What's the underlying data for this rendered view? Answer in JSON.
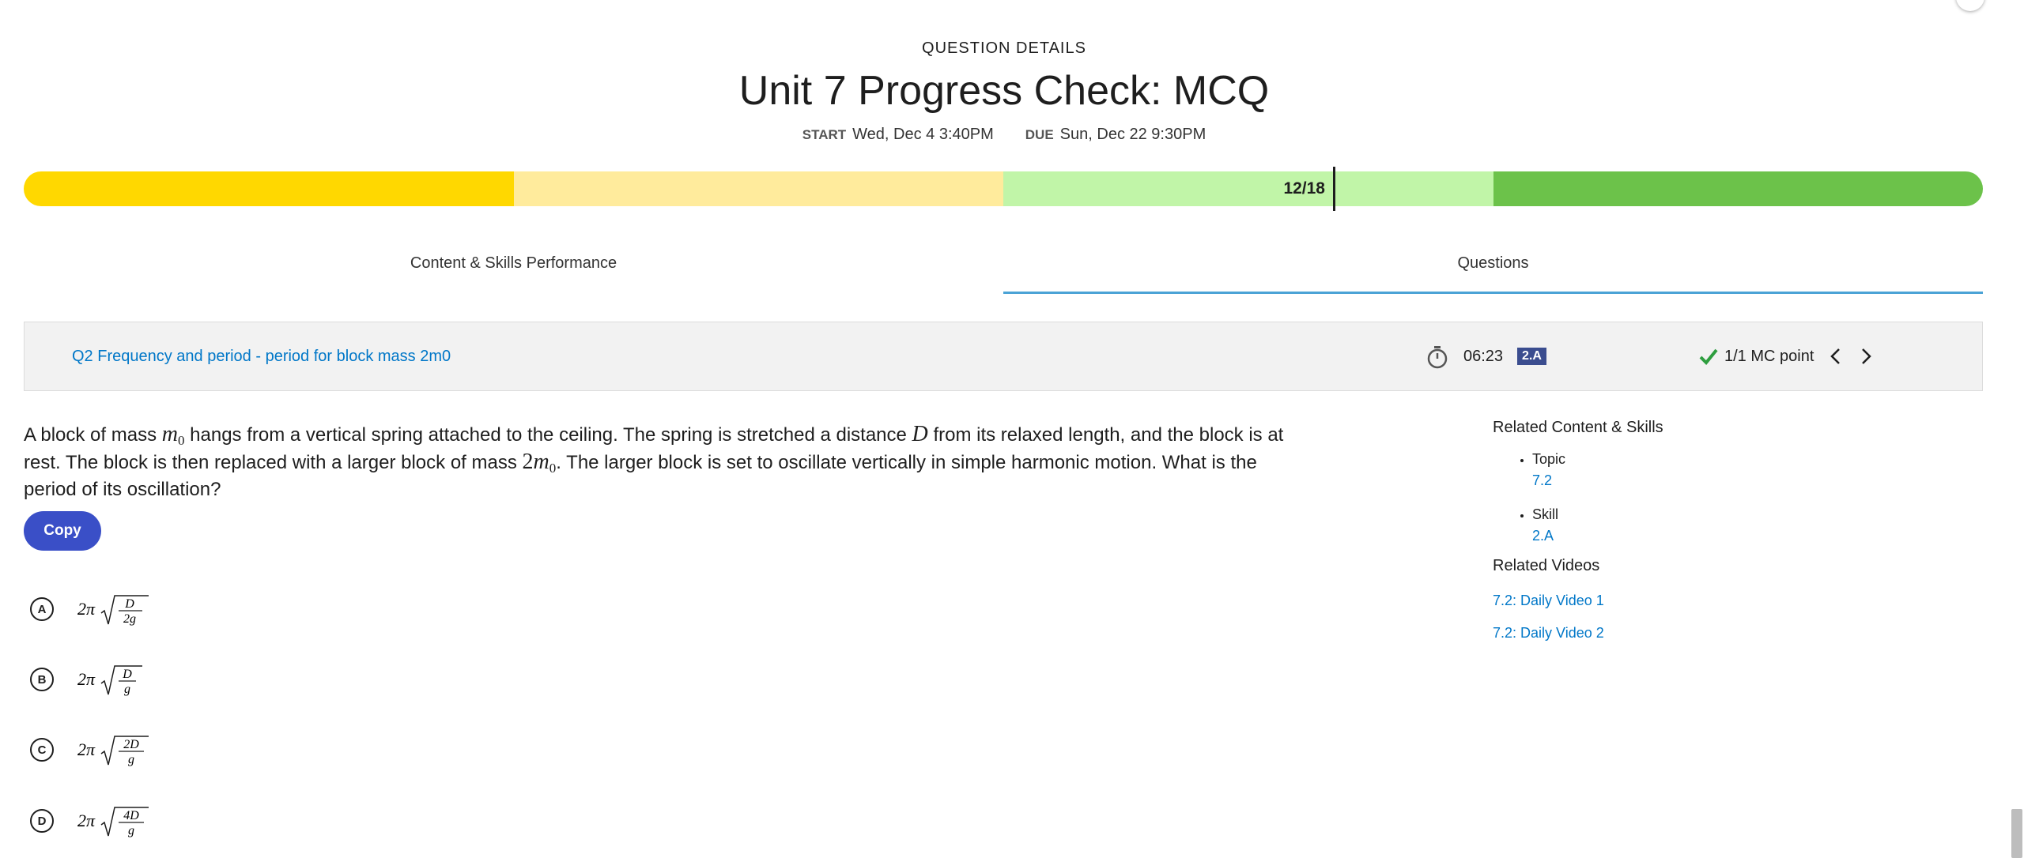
{
  "header": {
    "eyebrow": "QUESTION DETAILS",
    "title": "Unit 7 Progress Check: MCQ",
    "start_label": "START",
    "start_value": "Wed, Dec 4 3:40PM",
    "due_label": "DUE",
    "due_value": "Sun, Dec 22 9:30PM"
  },
  "progress": {
    "score": "12/18",
    "fraction": 0.667,
    "colors": [
      "#ffd800",
      "#ffeb9c",
      "#c1f5a8",
      "#6cc24a"
    ]
  },
  "tabs": [
    {
      "label": "Content & Skills Performance",
      "active": false
    },
    {
      "label": "Questions",
      "active": true
    }
  ],
  "question_bar": {
    "title": "Q2 Frequency and period - period for block mass 2m0",
    "time": "06:23",
    "skill_badge": "2.A",
    "points": "1/1 MC point"
  },
  "question": {
    "stem_1": "A block of mass ",
    "var_m": "m",
    "sub_0": "0",
    "stem_2": " hangs from a vertical spring attached to the ceiling. The spring is stretched a distance ",
    "var_D": "D",
    "stem_3": " from its relaxed length, and the block is at rest. The block is then replaced with a larger block of mass ",
    "coef_2": "2",
    "stem_4": ". The larger block is set to oscillate vertically in simple harmonic motion. What is the period of its oscillation?",
    "copy_label": "Copy"
  },
  "choices": [
    {
      "letter": "A",
      "prefix": "2π",
      "num": "D",
      "den": "2g"
    },
    {
      "letter": "B",
      "prefix": "2π",
      "num": "D",
      "den": "g"
    },
    {
      "letter": "C",
      "prefix": "2π",
      "num": "2D",
      "den": "g"
    },
    {
      "letter": "D",
      "prefix": "2π",
      "num": "4D",
      "den": "g"
    }
  ],
  "sidebar": {
    "related_heading": "Related Content & Skills",
    "topic_label": "Topic",
    "topic_value": "7.2",
    "skill_label": "Skill",
    "skill_value": "2.A",
    "videos_heading": "Related Videos",
    "videos": [
      "7.2: Daily Video 1",
      "7.2: Daily Video 2"
    ]
  },
  "colors": {
    "link": "#0077c8",
    "copy_button": "#3a4fc7",
    "badge": "#3b4d8f",
    "tab_underline": "#4ba3d6",
    "check": "#2e9e3f"
  }
}
